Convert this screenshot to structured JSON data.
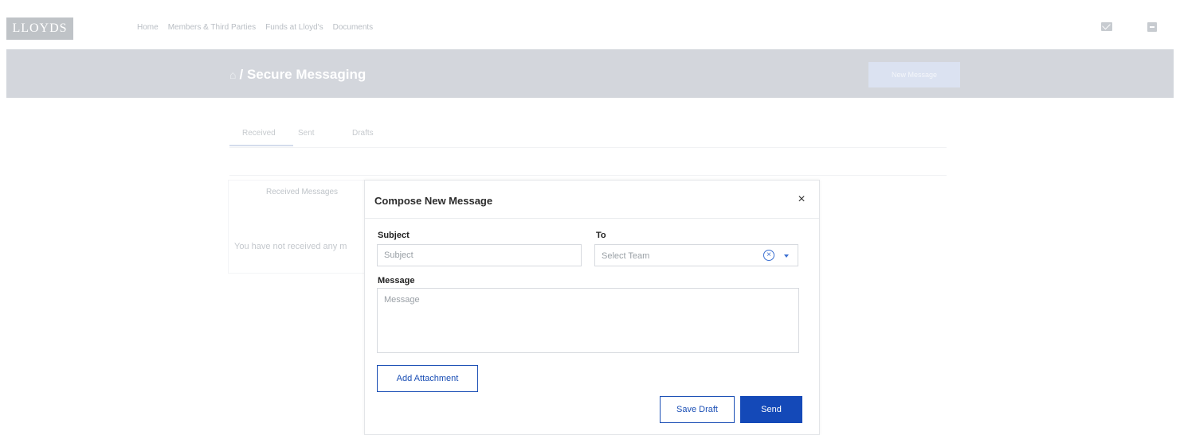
{
  "header": {
    "logo_text": "LLOYDS",
    "nav": [
      "Home",
      "Members & Third Parties",
      "Funds at Lloyd's",
      "Documents"
    ],
    "icons": [
      "mail-icon",
      "logout-icon"
    ]
  },
  "banner": {
    "breadcrumb_separator": "/",
    "title": "Secure Messaging",
    "new_message_label": "New Message"
  },
  "tabs": [
    "Received",
    "Sent",
    "Drafts"
  ],
  "received": {
    "heading": "Received Messages",
    "empty_text": "You have not received any m"
  },
  "modal": {
    "title": "Compose New Message",
    "close_glyph": "×",
    "subject": {
      "label": "Subject",
      "placeholder": "Subject",
      "value": ""
    },
    "to": {
      "label": "To",
      "placeholder": "Select Team"
    },
    "message": {
      "label": "Message",
      "placeholder": "Message",
      "value": ""
    },
    "add_attachment_label": "Add Attachment",
    "save_draft_label": "Save Draft",
    "send_label": "Send"
  },
  "colors": {
    "primary": "#1449b8",
    "banner": "#d3d6dc",
    "border": "#d7dadf"
  }
}
